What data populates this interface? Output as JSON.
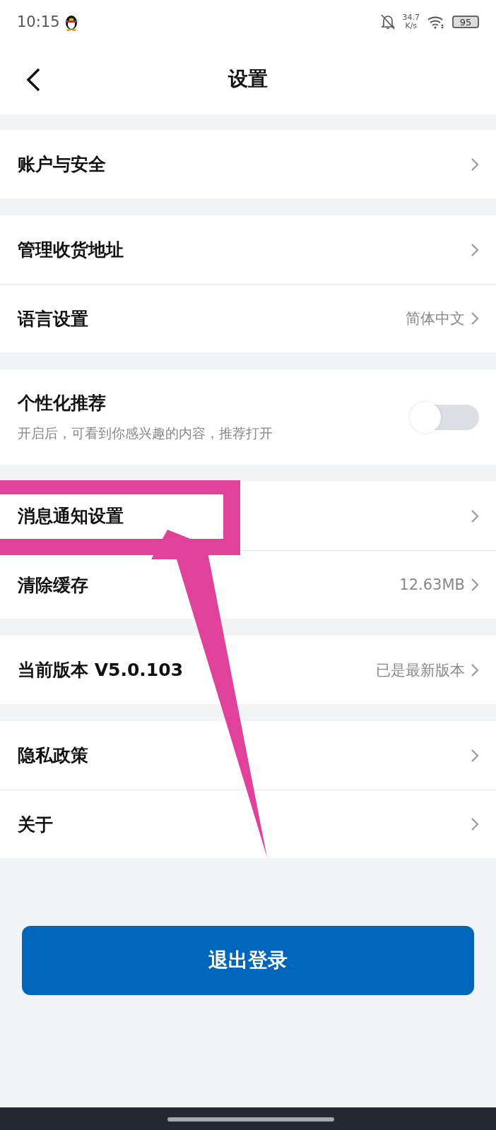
{
  "status_bar": {
    "time": "10:15",
    "speed": "34.7",
    "speed_unit": "K/s",
    "battery": "95"
  },
  "header": {
    "title": "设置"
  },
  "groups": [
    {
      "rows": [
        {
          "kind": "link",
          "label": "账户与安全"
        }
      ]
    },
    {
      "rows": [
        {
          "kind": "link",
          "label": "管理收货地址"
        },
        {
          "kind": "link",
          "label": "语言设置",
          "value": "简体中文"
        }
      ]
    },
    {
      "rows": [
        {
          "kind": "toggle",
          "label": "个性化推荐",
          "description": "开启后，可看到你感兴趣的内容，推荐打开",
          "on": false
        }
      ]
    },
    {
      "rows": [
        {
          "kind": "link",
          "label": "消息通知设置"
        },
        {
          "kind": "link",
          "label": "清除缓存",
          "value": "12.63MB"
        }
      ]
    },
    {
      "rows": [
        {
          "kind": "link",
          "label": "当前版本 V5.0.103",
          "value": "已是最新版本"
        }
      ]
    },
    {
      "rows": [
        {
          "kind": "link",
          "label": "隐私政策"
        },
        {
          "kind": "link",
          "label": "关于"
        }
      ]
    }
  ],
  "logout_button": "退出登录"
}
